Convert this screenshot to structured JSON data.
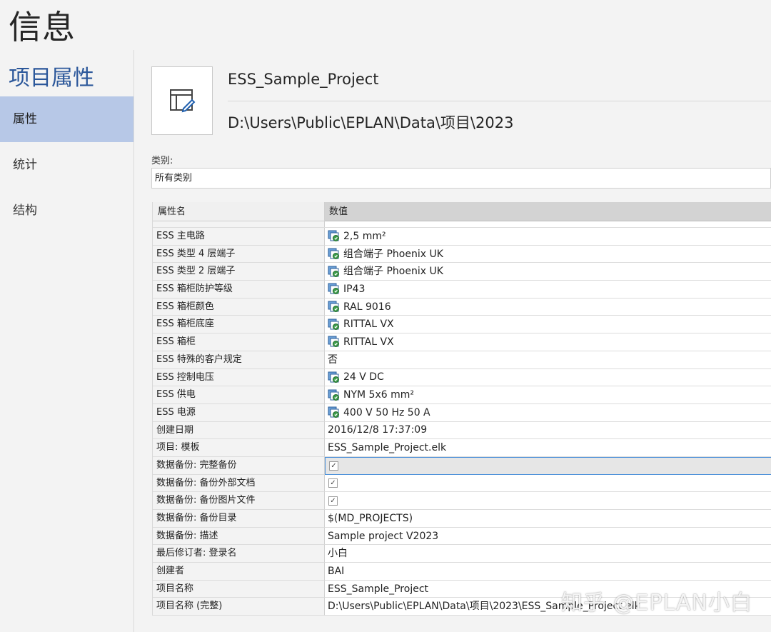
{
  "page_title": "信息",
  "sidebar": {
    "heading": "项目属性",
    "items": [
      {
        "label": "属性",
        "active": true
      },
      {
        "label": "统计",
        "active": false
      },
      {
        "label": "结构",
        "active": false
      }
    ]
  },
  "project": {
    "name": "ESS_Sample_Project",
    "path": "D:\\Users\\Public\\EPLAN\\Data\\项目\\2023"
  },
  "category": {
    "label": "类别:",
    "value": "所有类别"
  },
  "grid": {
    "col_name": "属性名",
    "col_value": "数值",
    "rows": [
      {
        "name": "ESS 主电路",
        "value": "2,5 mm²",
        "icon": true
      },
      {
        "name": "ESS 类型 4 层端子",
        "value": "组合端子 Phoenix UK",
        "icon": true
      },
      {
        "name": "ESS 类型 2 层端子",
        "value": "组合端子 Phoenix UK",
        "icon": true
      },
      {
        "name": "ESS 箱柜防护等级",
        "value": "IP43",
        "icon": true
      },
      {
        "name": "ESS 箱柜颜色",
        "value": "RAL 9016",
        "icon": true
      },
      {
        "name": "ESS 箱柜底座",
        "value": "RITTAL VX",
        "icon": true
      },
      {
        "name": "ESS 箱柜",
        "value": "RITTAL VX",
        "icon": true
      },
      {
        "name": "ESS 特殊的客户规定",
        "value": "否",
        "icon": false
      },
      {
        "name": "ESS 控制电压",
        "value": "24 V DC",
        "icon": true
      },
      {
        "name": "ESS 供电",
        "value": "NYM 5x6 mm²",
        "icon": true
      },
      {
        "name": "ESS 电源",
        "value": "400 V 50 Hz 50 A",
        "icon": true
      },
      {
        "name": "创建日期",
        "value": "2016/12/8 17:37:09",
        "icon": false
      },
      {
        "name": "项目: 模板",
        "value": "ESS_Sample_Project.elk",
        "icon": false
      },
      {
        "name": "数据备份: 完整备份",
        "checkbox": true,
        "checked": true,
        "selected": true
      },
      {
        "name": "数据备份: 备份外部文档",
        "checkbox": true,
        "checked": true
      },
      {
        "name": "数据备份: 备份图片文件",
        "checkbox": true,
        "checked": true
      },
      {
        "name": "数据备份: 备份目录",
        "value": "$(MD_PROJECTS)",
        "icon": false
      },
      {
        "name": "数据备份: 描述",
        "value": "Sample project V2023",
        "icon": false
      },
      {
        "name": "最后修订者: 登录名",
        "value": "小白",
        "icon": false
      },
      {
        "name": "创建者",
        "value": "BAI",
        "icon": false
      },
      {
        "name": "项目名称",
        "value": "ESS_Sample_Project",
        "icon": false
      },
      {
        "name": "项目名称 (完整)",
        "value": "D:\\Users\\Public\\EPLAN\\Data\\项目\\2023\\ESS_Sample_Project.elk",
        "icon": false
      }
    ]
  },
  "watermark": "知乎 @EPLAN小白",
  "colors": {
    "accent": "#2b579a",
    "nav_active_bg": "#b7c8e7",
    "header_value_bg": "#d3d3d3",
    "selection_border": "#4a90d9"
  }
}
